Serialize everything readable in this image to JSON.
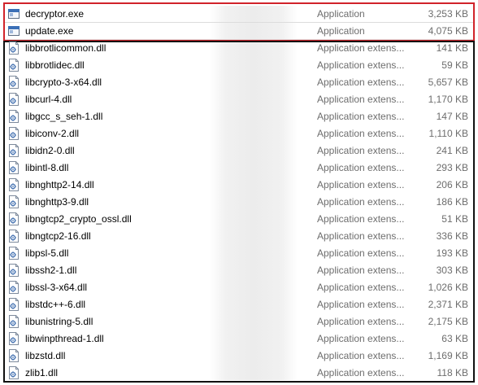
{
  "files": [
    {
      "name": "decryptor.exe",
      "type": "Application",
      "size": "3,253 KB",
      "icon": "exe-window-icon"
    },
    {
      "name": "update.exe",
      "type": "Application",
      "size": "4,075 KB",
      "icon": "exe-window-icon"
    },
    {
      "name": "libbrotlicommon.dll",
      "type": "Application extens...",
      "size": "141 KB",
      "icon": "dll-gear-icon"
    },
    {
      "name": "libbrotlidec.dll",
      "type": "Application extens...",
      "size": "59 KB",
      "icon": "dll-gear-icon"
    },
    {
      "name": "libcrypto-3-x64.dll",
      "type": "Application extens...",
      "size": "5,657 KB",
      "icon": "dll-gear-icon"
    },
    {
      "name": "libcurl-4.dll",
      "type": "Application extens...",
      "size": "1,170 KB",
      "icon": "dll-gear-icon"
    },
    {
      "name": "libgcc_s_seh-1.dll",
      "type": "Application extens...",
      "size": "147 KB",
      "icon": "dll-gear-icon"
    },
    {
      "name": "libiconv-2.dll",
      "type": "Application extens...",
      "size": "1,110 KB",
      "icon": "dll-gear-icon"
    },
    {
      "name": "libidn2-0.dll",
      "type": "Application extens...",
      "size": "241 KB",
      "icon": "dll-gear-icon"
    },
    {
      "name": "libintl-8.dll",
      "type": "Application extens...",
      "size": "293 KB",
      "icon": "dll-gear-icon"
    },
    {
      "name": "libnghttp2-14.dll",
      "type": "Application extens...",
      "size": "206 KB",
      "icon": "dll-gear-icon"
    },
    {
      "name": "libnghttp3-9.dll",
      "type": "Application extens...",
      "size": "186 KB",
      "icon": "dll-gear-icon"
    },
    {
      "name": "libngtcp2_crypto_ossl.dll",
      "type": "Application extens...",
      "size": "51 KB",
      "icon": "dll-gear-icon"
    },
    {
      "name": "libngtcp2-16.dll",
      "type": "Application extens...",
      "size": "336 KB",
      "icon": "dll-gear-icon"
    },
    {
      "name": "libpsl-5.dll",
      "type": "Application extens...",
      "size": "193 KB",
      "icon": "dll-gear-icon"
    },
    {
      "name": "libssh2-1.dll",
      "type": "Application extens...",
      "size": "303 KB",
      "icon": "dll-gear-icon"
    },
    {
      "name": "libssl-3-x64.dll",
      "type": "Application extens...",
      "size": "1,026 KB",
      "icon": "dll-gear-icon"
    },
    {
      "name": "libstdc++-6.dll",
      "type": "Application extens...",
      "size": "2,371 KB",
      "icon": "dll-gear-icon"
    },
    {
      "name": "libunistring-5.dll",
      "type": "Application extens...",
      "size": "2,175 KB",
      "icon": "dll-gear-icon"
    },
    {
      "name": "libwinpthread-1.dll",
      "type": "Application extens...",
      "size": "63 KB",
      "icon": "dll-gear-icon"
    },
    {
      "name": "libzstd.dll",
      "type": "Application extens...",
      "size": "1,169 KB",
      "icon": "dll-gear-icon"
    },
    {
      "name": "zlib1.dll",
      "type": "Application extens...",
      "size": "118 KB",
      "icon": "dll-gear-icon"
    }
  ],
  "colors": {
    "highlight_border": "#d1232a",
    "list_border": "#111111",
    "secondary_text": "#6d6d6d"
  }
}
